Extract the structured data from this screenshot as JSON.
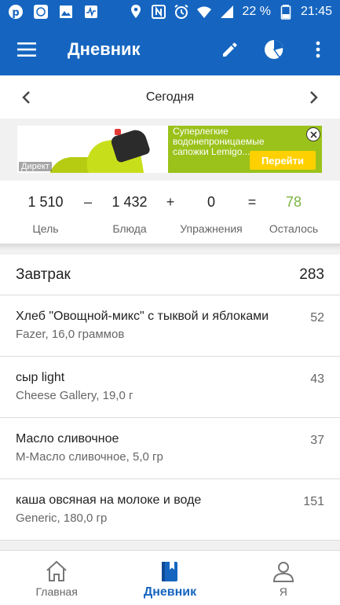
{
  "status_bar": {
    "battery_percent": "22 %",
    "time": "21:45",
    "icons_left": [
      "pinterest-icon",
      "app-badge-icon",
      "image-icon",
      "activity-icon"
    ],
    "icons_right": [
      "location-icon",
      "nfc-icon",
      "alarm-icon",
      "wifi-icon",
      "signal-icon",
      "battery-icon"
    ]
  },
  "app_bar": {
    "title": "Дневник",
    "icons": [
      "menu-icon",
      "edit-icon",
      "pie-chart-icon",
      "more-icon"
    ]
  },
  "date_nav": {
    "label": "Сегодня"
  },
  "ad": {
    "source": "Директ",
    "text": "Суперлегкие водонепроницаемые сапожки Lemigo...",
    "cta": "Перейти"
  },
  "summary": {
    "goal": {
      "value": "1 510",
      "label": "Цель"
    },
    "food": {
      "value": "1 432",
      "label": "Блюда"
    },
    "exercise": {
      "value": "0",
      "label": "Упражнения"
    },
    "remaining": {
      "value": "78",
      "label": "Осталось"
    },
    "op_minus": "–",
    "op_plus": "+",
    "op_equals": "=",
    "remaining_color": "#7cb342"
  },
  "meal": {
    "title": "Завтрак",
    "calories": "283",
    "items": [
      {
        "name": "Хлеб \"Овощной-микс\" с тыквой и яблоками",
        "detail": "Fazer, 16,0 граммов",
        "calories": "52"
      },
      {
        "name": "сыр light",
        "detail": "Cheese Gallery, 19,0 г",
        "calories": "43"
      },
      {
        "name": "Масло сливочное",
        "detail": "М-Масло сливочное, 5,0 гр",
        "calories": "37"
      },
      {
        "name": "каша овсяная на молоке и воде",
        "detail": "Generic, 180,0 гр",
        "calories": "151"
      }
    ]
  },
  "bottom_nav": {
    "items": [
      {
        "label": "Главная",
        "icon": "home-icon"
      },
      {
        "label": "Дневник",
        "icon": "diary-icon",
        "active": true
      },
      {
        "label": "Я",
        "icon": "profile-icon"
      }
    ]
  },
  "colors": {
    "primary": "#1565c0",
    "ad_green": "#9bc21b",
    "ad_button": "#ffd000"
  }
}
